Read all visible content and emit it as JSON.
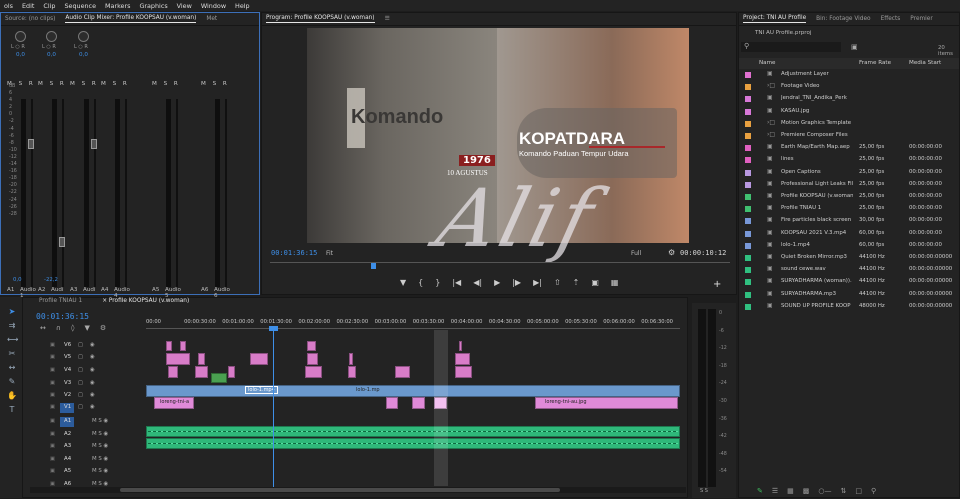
{
  "menu": [
    "ols",
    "Edit",
    "Clip",
    "Sequence",
    "Markers",
    "Graphics",
    "View",
    "Window",
    "Help"
  ],
  "left_panel": {
    "tabs": [
      "Source: (no clips)",
      "Audio Clip Mixer: Profile KOOPSAU (v.woman)",
      "Met"
    ],
    "channels": [
      {
        "label": "Audio 1",
        "short": "A1",
        "lr": "L ○ R",
        "val": "0,0",
        "foot": "0,0"
      },
      {
        "label": "Audi",
        "short": "A2",
        "lr": "L ○ R",
        "val": "0,0",
        "foot": "-22,2"
      },
      {
        "label": "Audi",
        "short": "A3",
        "lr": "L ○ R",
        "val": "0,0",
        "foot": ""
      },
      {
        "label": "Audio 4",
        "short": "A4",
        "lr": "",
        "val": "",
        "foot": ""
      },
      {
        "label": "Audio 5",
        "short": "A5",
        "lr": "",
        "val": "",
        "foot": ""
      },
      {
        "label": "Audio 6",
        "short": "A6",
        "lr": "",
        "val": "",
        "foot": ""
      }
    ],
    "msr": "M S R",
    "msr2": "M S ◉",
    "db": [
      "dB",
      "6",
      "4",
      "2",
      "0",
      "-2",
      "-4",
      "-6",
      "-8",
      "-10",
      "-12",
      "-14",
      "-16",
      "-18",
      "-20",
      "-22",
      "-24",
      "-26",
      "-28"
    ]
  },
  "program": {
    "tab": "Program: Profile KOOPSAU (v.woman)",
    "tc_left": "00:01:36:15",
    "tc_right": "00:00:10:12",
    "fit": "Fit",
    "full": "Full",
    "overlay": {
      "komando": "Komando",
      "title": "KOPATDARA",
      "subtitle": "Komando Paduan Tempur Udara",
      "year": "1976",
      "date": "10 AGUSTUS",
      "watermark": "Alif"
    }
  },
  "project": {
    "tabs": [
      "Project: TNI AU Profile",
      "Bin: Footage Video",
      "Effects",
      "Premier"
    ],
    "file": "TNI AU Profile.prproj",
    "count": "20 items",
    "search_icon": "search-icon",
    "columns": [
      "Name",
      "Frame Rate",
      "Media Start"
    ],
    "items": [
      {
        "name": "Adjustment Layer",
        "color": "#e070d0",
        "fr": "",
        "ms": ""
      },
      {
        "name": "Footage Video",
        "color": "#e8a040",
        "fr": "",
        "ms": ""
      },
      {
        "name": "Jendral_TNI_Andika_Perk",
        "color": "#d878d8",
        "fr": "",
        "ms": ""
      },
      {
        "name": "KASAU.jpg",
        "color": "#d878d8",
        "fr": "",
        "ms": ""
      },
      {
        "name": "Motion Graphics Template",
        "color": "#e8a040",
        "fr": "",
        "ms": ""
      },
      {
        "name": "Premiere Composer Files",
        "color": "#e8a040",
        "fr": "",
        "ms": ""
      },
      {
        "name": "Earth Map/Earth Map.aep",
        "color": "#e060c0",
        "fr": "25,00 fps",
        "ms": "00:00:00:00"
      },
      {
        "name": "lines",
        "color": "#e060c0",
        "fr": "25,00 fps",
        "ms": "00:00:00:00"
      },
      {
        "name": "Open Captions",
        "color": "#b898e0",
        "fr": "25,00 fps",
        "ms": "00:00:00:00"
      },
      {
        "name": "Professional Light Leaks Fil",
        "color": "#b898e0",
        "fr": "25,00 fps",
        "ms": "00:00:00:00"
      },
      {
        "name": "Profile KOOPSAU (v.woman",
        "color": "#40c070",
        "fr": "25,00 fps",
        "ms": "00:00:00:00"
      },
      {
        "name": "Profile TNIAU 1",
        "color": "#40c070",
        "fr": "25,00 fps",
        "ms": "00:00:00:00"
      },
      {
        "name": "Fire particles black screen v",
        "color": "#7898d8",
        "fr": "30,00 fps",
        "ms": "00:00:00:00"
      },
      {
        "name": "KOOPSAU 2021 V.3.mp4",
        "color": "#7898d8",
        "fr": "60,00 fps",
        "ms": "00:00:00:00"
      },
      {
        "name": "lolo-1.mp4",
        "color": "#7898d8",
        "fr": "60,00 fps",
        "ms": "00:00:00:00"
      },
      {
        "name": "Quiet Broken Mirror.mp3",
        "color": "#30c080",
        "fr": "44100 Hz",
        "ms": "00:00:00:00000"
      },
      {
        "name": "sound cewe.wav",
        "color": "#30c080",
        "fr": "44100 Hz",
        "ms": "00:00:00:00000"
      },
      {
        "name": "SURYADHARMA (woman)).",
        "color": "#30c080",
        "fr": "44100 Hz",
        "ms": "00:00:00:00000"
      },
      {
        "name": "SURYADHARMA.mp3",
        "color": "#30c080",
        "fr": "44100 Hz",
        "ms": "00:00:00:00000"
      },
      {
        "name": "SOUND UP PROFILE KOOP",
        "color": "#30c080",
        "fr": "48000 Hz",
        "ms": "00:00:00:00000"
      }
    ]
  },
  "timeline": {
    "tabs": [
      "Profile TNIAU 1",
      "Profile KOOPSAU (v.woman)"
    ],
    "tc": "00:01:36:15",
    "ruler": [
      "00:00",
      "00:00:30:00",
      "00:01:00:00",
      "00:01:30:00",
      "00:02:00:00",
      "00:02:30:00",
      "00:03:00:00",
      "00:03:30:00",
      "00:04:00:00",
      "00:04:30:00",
      "00:05:00:00",
      "00:05:30:00",
      "00:06:00:00",
      "00:06:30:00"
    ],
    "video_tracks": [
      "V6",
      "V5",
      "V4",
      "V3",
      "V2",
      "V1"
    ],
    "audio_tracks": [
      "A1",
      "A2",
      "A3",
      "A4",
      "A5",
      "A6"
    ],
    "clip_labels": {
      "loreng1": "loreng-tni-a",
      "lolo": "lolo-1.mp4",
      "lolo2": "lolo-1.mp",
      "loreng2": "loreng-tni-au.jpg"
    },
    "meter_db": [
      "0",
      "-6",
      "-12",
      "-18",
      "-24",
      "-30",
      "-36",
      "-42",
      "-48",
      "-54"
    ],
    "meter_foot": "S S"
  }
}
